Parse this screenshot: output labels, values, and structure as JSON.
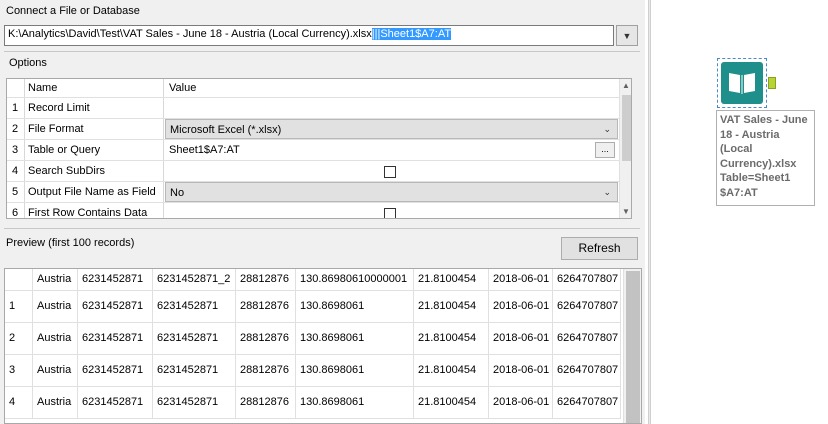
{
  "connect": {
    "label": "Connect a File or Database",
    "path_main": "K:\\Analytics\\David\\Test\\VAT Sales - June 18 - Austria (Local Currency).xlsx",
    "path_selected": "|||Sheet1$A7:AT"
  },
  "options": {
    "label": "Options",
    "col_name": "Name",
    "col_value": "Value",
    "rows": [
      {
        "num": "1",
        "name": "Record Limit",
        "value": ""
      },
      {
        "num": "2",
        "name": "File Format",
        "value": "Microsoft Excel (*.xlsx)"
      },
      {
        "num": "3",
        "name": "Table or Query",
        "value": "Sheet1$A7:AT"
      },
      {
        "num": "4",
        "name": "Search SubDirs",
        "value": ""
      },
      {
        "num": "5",
        "name": "Output File Name as Field",
        "value": "No"
      },
      {
        "num": "6",
        "name": "First Row Contains Data",
        "value": ""
      }
    ],
    "browse_label": "..."
  },
  "preview": {
    "label": "Preview (first 100 records)",
    "refresh_label": "Refresh",
    "header": [
      "",
      "Austria",
      "6231452871",
      "6231452871_2",
      "28812876",
      "130.86980610000001",
      "21.8100454",
      "2018-06-01",
      "6264707807"
    ],
    "rows": [
      [
        "1",
        "Austria",
        "6231452871",
        "6231452871",
        "28812876",
        "130.8698061",
        "21.8100454",
        "2018-06-01",
        "6264707807"
      ],
      [
        "2",
        "Austria",
        "6231452871",
        "6231452871",
        "28812876",
        "130.8698061",
        "21.8100454",
        "2018-06-01",
        "6264707807"
      ],
      [
        "3",
        "Austria",
        "6231452871",
        "6231452871",
        "28812876",
        "130.8698061",
        "21.8100454",
        "2018-06-01",
        "6264707807"
      ],
      [
        "4",
        "Austria",
        "6231452871",
        "6231452871",
        "28812876",
        "130.8698061",
        "21.8100454",
        "2018-06-01",
        "6264707807"
      ]
    ]
  },
  "tool": {
    "icon": "book-input-icon",
    "label_lines": [
      "VAT Sales - June",
      "18 - Austria",
      "(Local",
      "Currency).xlsx",
      "Table=Sheet1",
      "$A7:AT"
    ]
  },
  "colors": {
    "selection": "#3399ff",
    "tool_teal": "#1e8f8a",
    "connector": "#b8d432"
  }
}
